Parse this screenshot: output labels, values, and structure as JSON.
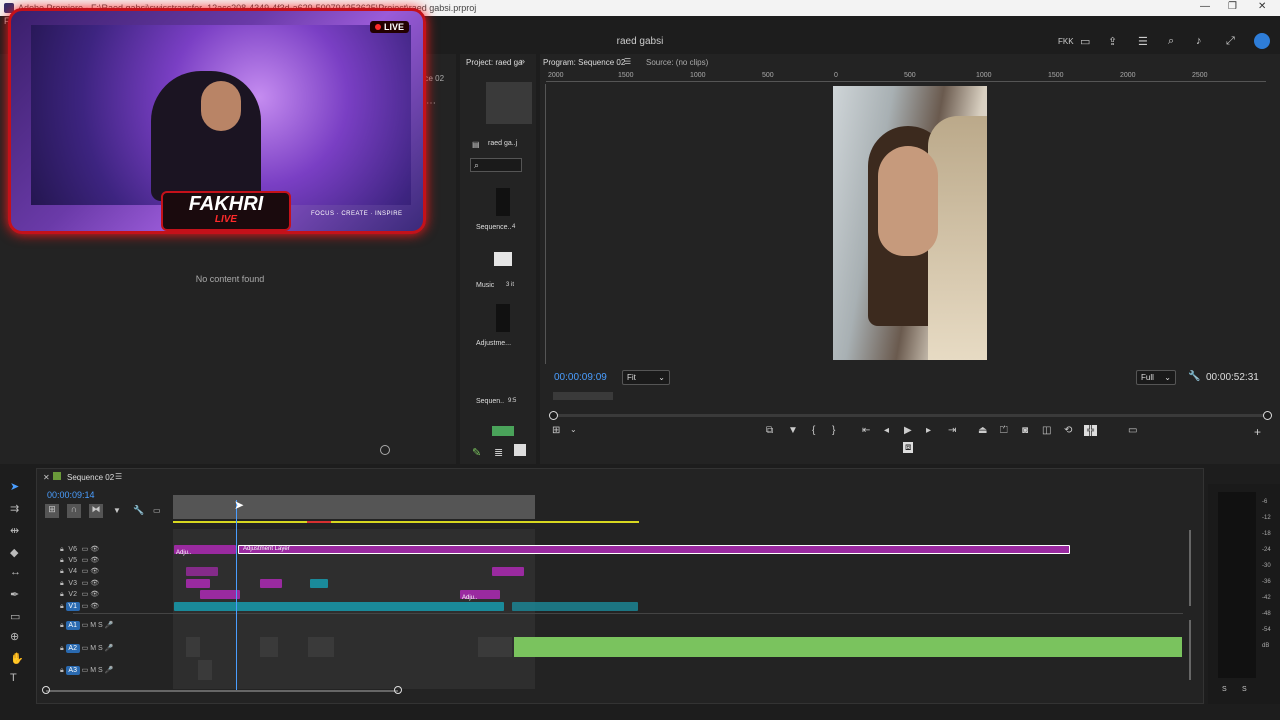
{
  "titlebar": {
    "text": "Adobe Premiere - F:\\Raed gabsi\\swisstransfer_12acc208-4349-4f3d-a629-500794253625\\Project\\raed gabsi.prproj"
  },
  "menubar": {
    "first": "File"
  },
  "header": {
    "title": "raed gabsi",
    "workspace": "FKK"
  },
  "webcam": {
    "live": "LIVE",
    "brand_main": "FAKHRI",
    "brand_sub": "LIVE",
    "tagline": "FOCUS · CREATE · INSPIRE"
  },
  "left_panel": {
    "tab_partial": "nce 02",
    "empty_text": "No content found"
  },
  "project_panel": {
    "tab": "Project: raed ga",
    "items": [
      {
        "label": "raed ga..j"
      },
      {
        "label": "Sequence..",
        "count": "4"
      },
      {
        "label": "Music",
        "count": "3 it"
      },
      {
        "label": "Adjustme..."
      },
      {
        "label": "Sequen..",
        "count": "9:5"
      }
    ]
  },
  "program": {
    "tab": "Program: Sequence 02",
    "source_tab": "Source: (no clips)",
    "timecode": "00:00:09:09",
    "zoom": "Fit",
    "quality": "Full",
    "duration": "00:00:52:31",
    "ruler_labels": [
      "2000",
      "1500",
      "1000",
      "500",
      "0",
      "500",
      "1000",
      "1500",
      "2000",
      "2500"
    ]
  },
  "timeline": {
    "tab": "Sequence 02",
    "timecode": "00:00:09:14",
    "video_tracks": [
      "V6",
      "V5",
      "V4",
      "V3",
      "V2",
      "V1"
    ],
    "audio_tracks": [
      "A1",
      "A2",
      "A3"
    ],
    "adjustment_label": "Adjustment Layer",
    "adju_short": "Adju..",
    "db_labels": [
      "-6",
      "-12",
      "-18",
      "-24",
      "-30",
      "-36",
      "-42",
      "-48",
      "-54",
      "dB"
    ],
    "meter_bottom": [
      "S",
      "S"
    ]
  }
}
